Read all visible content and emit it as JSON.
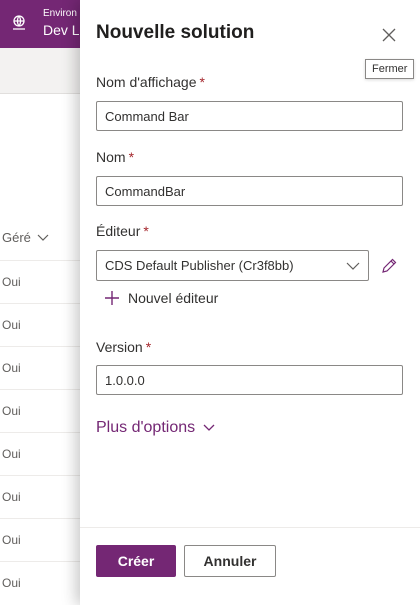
{
  "background": {
    "environment_label": "Environ",
    "environment_name": "Dev La",
    "column_header": "Géré",
    "rows": [
      "Oui",
      "Oui",
      "Oui",
      "Oui",
      "Oui",
      "Oui",
      "Oui",
      "Oui"
    ]
  },
  "panel": {
    "title": "Nouvelle solution",
    "close_tooltip": "Fermer",
    "display_name": {
      "label": "Nom d'affichage",
      "value": "Command Bar"
    },
    "name": {
      "label": "Nom",
      "value": "CommandBar"
    },
    "publisher": {
      "label": "Éditeur",
      "selected": "CDS Default Publisher (Cr3f8bb)",
      "new_label": "Nouvel éditeur"
    },
    "version": {
      "label": "Version",
      "value": "1.0.0.0"
    },
    "more_options": "Plus d'options",
    "required_mark": "*",
    "buttons": {
      "create": "Créer",
      "cancel": "Annuler"
    }
  },
  "colors": {
    "brand": "#742774",
    "required": "#a4262c"
  }
}
